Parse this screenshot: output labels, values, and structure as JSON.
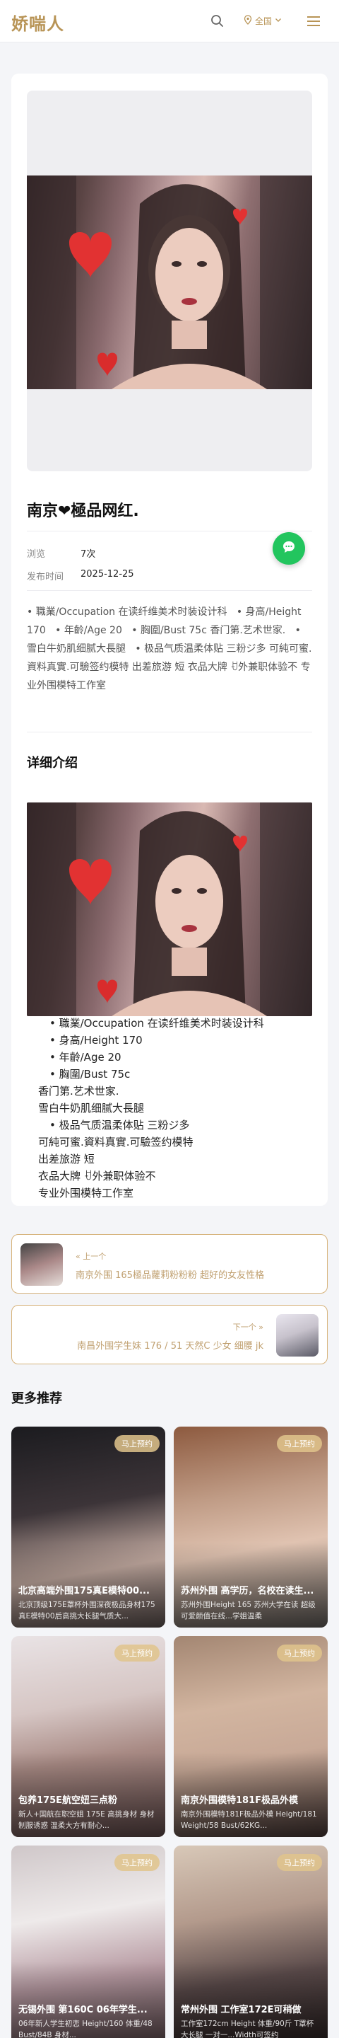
{
  "header": {
    "logo": "娇喘人",
    "location_label": "全国",
    "icons": [
      "search-icon",
      "location-pin-icon",
      "chevron-down-icon",
      "menu-icon"
    ]
  },
  "post": {
    "title": "南京❤極品网红.",
    "meta": [
      {
        "label": "浏览",
        "value": "7次"
      },
      {
        "label": "发布时间",
        "value": "2025-12-25"
      }
    ],
    "summary": [
      "職業/Occupation 在读纤维美术时装设计科",
      "身高/Height 170",
      "年齡/Age 20",
      "胸圍/Bust 75c 香门第.艺术世家.",
      "雪白牛奶肌细腻大長腿",
      "极品气质温柔体贴 三粉ジ多 可純可蜜.資料真實.可驗签约模特 出差旅游 短 衣品大牌 ꀀ外兼职体验不 专业外围模特工作室"
    ]
  },
  "detail": {
    "section_title": "详细介绍",
    "lines": [
      "職業/Occupation 在读纤维美术时装设计科",
      "身高/Height 170",
      "年齡/Age 20",
      "胸圍/Bust 75c",
      "香门第.艺术世家.",
      "雪白牛奶肌细腻大長腿",
      "极品气质温柔体贴 三粉ジ多",
      "可純可蜜.資料真實.可驗签约模特",
      "出差旅游 短",
      "衣品大牌 ꀀ外兼职体验不",
      "专业外围模特工作室"
    ]
  },
  "nav": {
    "prev_label": "« 上一个",
    "prev_title": "南京外围 165極品蘿莉粉粉粉 超好的女友性格",
    "next_label": "下一个 »",
    "next_title": "南昌外围学生妹 176 / 51 天然C 少女 细腰 jk"
  },
  "recommend": {
    "section_title": "更多推荐",
    "badge": "马上预约",
    "items": [
      {
        "name": "北京高端外围175真E模特00...",
        "desc": "北京顶级175E罩杯外围深夜极品身材175真E模特00后高挑大长腿气质大..."
      },
      {
        "name": "苏州外围 高学历，名校在读生...",
        "desc": "苏州外围Height 165 苏州大学在读 超级可爱颜值在线...学姐温柔"
      },
      {
        "name": "包养175E航空妞三点粉",
        "desc": "新人+国航在职空姐 175E 高挑身材 身材 制服诱惑 温柔大方有耐心..."
      },
      {
        "name": "南京外围模特181F极品外模",
        "desc": "南京外围模特181F极品外模 Height/181 Weight/58 Bust/62KG..."
      },
      {
        "name": "无锡外围 第160C 06年学生...",
        "desc": "06年新人学生初恋 Height/160 体重/48 Bust/84B 身材..."
      },
      {
        "name": "常州外围 工作室172E可稍做",
        "desc": "工作室172cm Height 体重/90斤 T罩杯 大长腿 一对一...Width可签约"
      }
    ]
  },
  "colors": {
    "accent_gold": "#b89456",
    "fab_green": "#22c55e",
    "page_bg": "#f4f5f8"
  }
}
